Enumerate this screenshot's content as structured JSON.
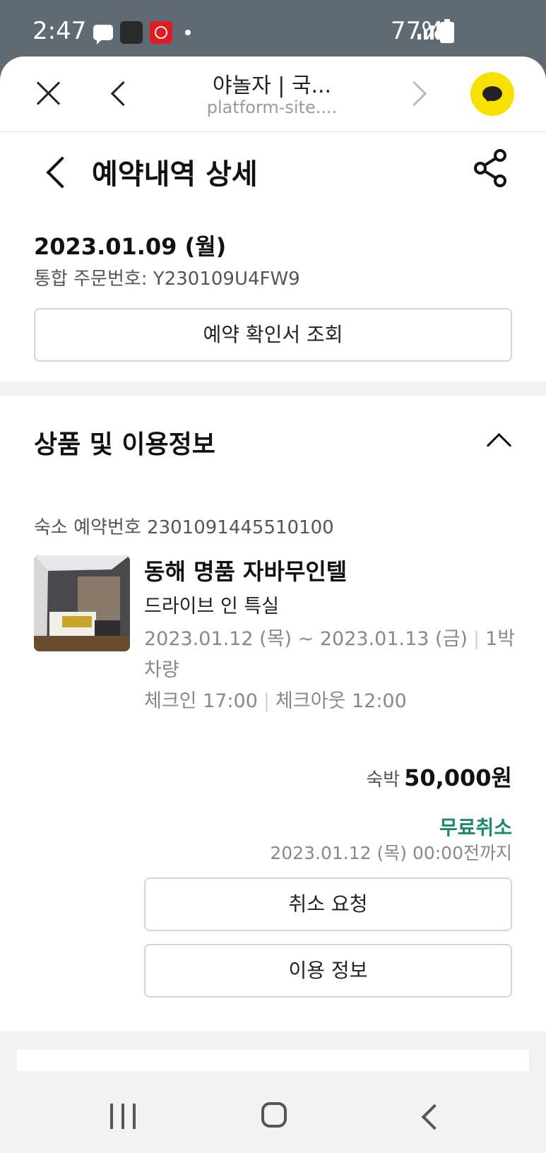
{
  "status_bar": {
    "time": "2:47",
    "battery": "77%"
  },
  "browser": {
    "title": "야놀자 | 국...",
    "url": "platform-site...."
  },
  "page": {
    "title": "예약내역 상세"
  },
  "order": {
    "date": "2023.01.09 (월)",
    "order_number": "통합 주문번호: Y230109U4FW9",
    "confirm_button": "예약 확인서 조회"
  },
  "section": {
    "title": "상품 및 이용정보"
  },
  "reservation": {
    "number": "숙소 예약번호 2301091445510100",
    "hotel_name": "동해 명품 자바무인텔",
    "room_type": "드라이브 인 특실",
    "stay_dates": "2023.01.12 (목) ~ 2023.01.13 (금)",
    "nights": "1박",
    "vehicle": "차량",
    "checkin": "체크인 17:00",
    "checkout": "체크아웃 12:00",
    "price_label": "숙박",
    "price": "50,000원",
    "cancel_policy": "무료취소",
    "cancel_deadline": "2023.01.12 (목) 00:00전까지",
    "cancel_button": "취소 요청",
    "info_button": "이용 정보"
  },
  "colors": {
    "accent_green": "#1a8a6b",
    "kakao_yellow": "#f8e000"
  }
}
